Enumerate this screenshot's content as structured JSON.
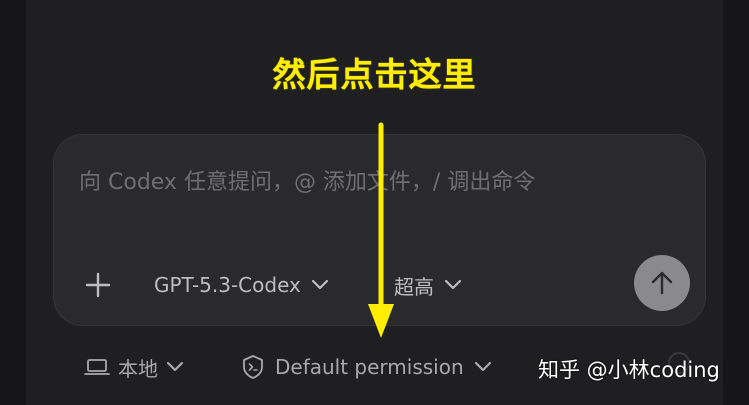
{
  "annotation": {
    "text": "然后点击这里"
  },
  "composer": {
    "placeholder": "向 Codex 任意提问，@ 添加文件，/ 调出命令",
    "value": "",
    "model_label": "GPT-5.3-Codex",
    "effort_label": "超高"
  },
  "bottom_bar": {
    "env_label": "本地",
    "permission_label": "Default permission"
  },
  "watermark": {
    "text": "知乎 @小林coding"
  },
  "colors": {
    "annotation": "#ffee00",
    "panel": "#1f1f21",
    "composer_bg": "#2a2a2c",
    "send_button": "#8a8a8c"
  },
  "icons": {
    "add": "plus-icon",
    "model": "chevron-down-icon",
    "effort": "chevron-down-icon",
    "send": "arrow-up-icon",
    "env": "laptop-icon",
    "permission": "shield-terminal-icon"
  }
}
